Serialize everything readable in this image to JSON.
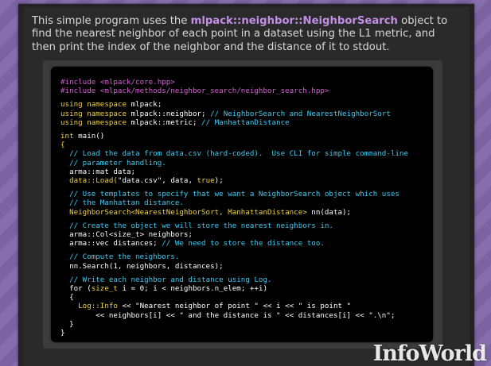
{
  "intro": {
    "before": "This simple program uses the ",
    "class_name": "mlpack::neighbor::NeighborSearch",
    "after": " object to find the nearest neighbor of each point in a dataset using the L1 metric, and then print the index of the neighbor and the distance of it to stdout."
  },
  "code": {
    "l1": "#include <mlpack/core.hpp>",
    "l2": "#include <mlpack/methods/neighbor_search/neighbor_search.hpp>",
    "l3a": "using namespace",
    "l3b": " mlpack;",
    "l4a": "using namespace",
    "l4b": " mlpack::neighbor;",
    "l4c": " // NeighborSearch and NearestNeighborSort",
    "l5a": "using namespace",
    "l5b": " mlpack::metric;",
    "l5c": " // ManhattanDistance",
    "l6a": "int",
    "l6b": " main()",
    "l7": "{",
    "l8": "  // Load the data from data.csv (hard-coded).  Use CLI for simple command-line",
    "l9": "  // parameter handling.",
    "l10": "  arma::mat data;",
    "l11a": "  data::Load(",
    "l11b": "\"data.csv\"",
    "l11c": ", data, ",
    "l11d": "true",
    "l11e": ");",
    "l12": "  // Use templates to specify that we want a NeighborSearch object which uses",
    "l13": "  // the Manhattan distance.",
    "l14a": "  NeighborSearch<NearestNeighborSort, ManhattanDistance>",
    "l14b": " nn(data);",
    "l15": "  // Create the object we will store the nearest neighbors in.",
    "l16": "  arma::Col<size_t> neighbors;",
    "l17a": "  arma::vec distances;",
    "l17b": " // We need to store the distance too.",
    "l18": "  // Compute the neighbors.",
    "l19": "  nn.Search(1, neighbors, distances);",
    "l20": "  // Write each neighbor and distance using Log.",
    "l21a": "  for (",
    "l21b": "size_t",
    "l21c": " i = 0; i < neighbors.n_elem; ++i)",
    "l22": "  {",
    "l23a": "    Log::Info",
    "l23b": " << \"Nearest neighbor of point \" << i << \" is point \"",
    "l24": "        << neighbors[i] << \" and the distance is \" << distances[i] << \".\\n\";",
    "l25": "  }",
    "l26": "}"
  },
  "logo": "InfoWorld"
}
